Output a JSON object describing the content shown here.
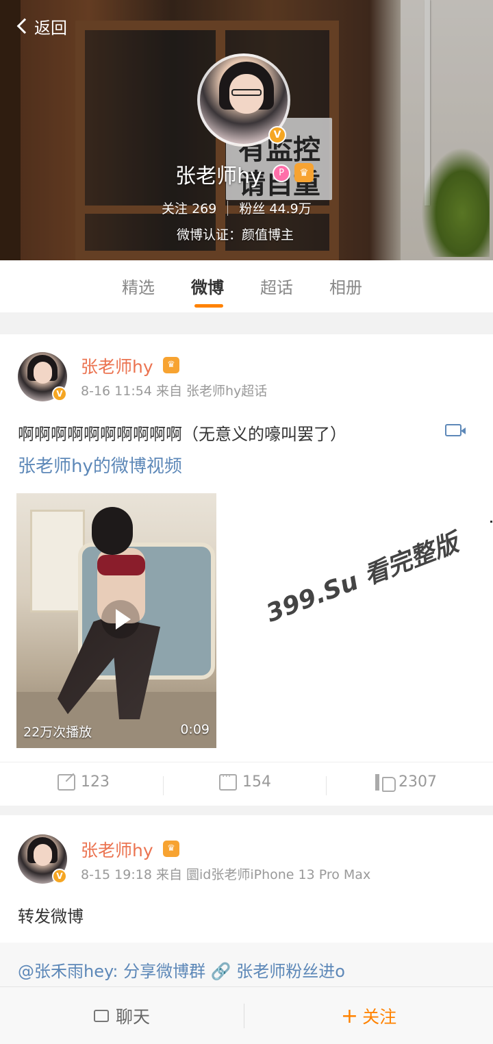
{
  "header": {
    "back_label": "返回",
    "profile_name": "张老师hy",
    "following_label": "关注",
    "following_count": "269",
    "followers_label": "粉丝",
    "followers_count": "44.9万",
    "verification": "微博认证：颜值博主",
    "sign_line1": "有监控",
    "sign_line2": "请自重"
  },
  "tabs": [
    {
      "label": "精选"
    },
    {
      "label": "微博",
      "active": true
    },
    {
      "label": "超话"
    },
    {
      "label": "相册"
    }
  ],
  "posts": [
    {
      "author": "张老师hy",
      "meta": "8-16 11:54 来自 张老师hy超话",
      "text": "啊啊啊啊啊啊啊啊啊啊（无意义的嚎叫罢了）",
      "video_link": "张老师hy的微博视频",
      "video": {
        "play_count": "22万次播放",
        "duration": "0:09"
      },
      "actions": {
        "share": "123",
        "comments": "154",
        "likes": "2307"
      }
    },
    {
      "author": "张老师hy",
      "meta": "8-15 19:18 来自 圜id张老师iPhone 13 Pro Max",
      "text": "转发微博",
      "repost": "@张禾雨hey: 分享微博群 🔗 张老师粉丝进o"
    }
  ],
  "watermark": "399.Su 看完整版",
  "bottom_bar": {
    "chat_label": "聊天",
    "follow_label": "关注",
    "follow_plus": "+"
  },
  "colors": {
    "accent": "#ff8200",
    "name": "#eb7350",
    "link": "#5d88b8",
    "badge": "#f5a623"
  }
}
